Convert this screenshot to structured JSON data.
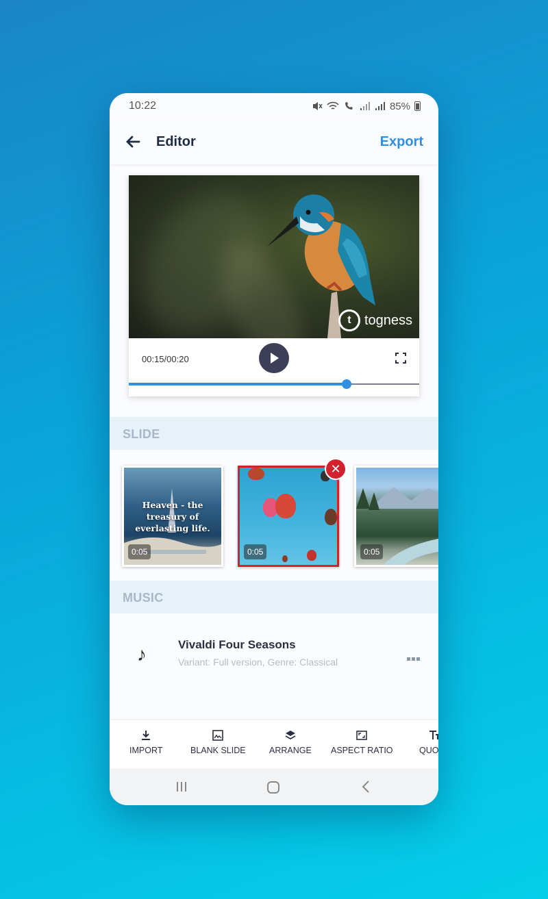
{
  "status_bar": {
    "time": "10:22",
    "battery": "85%"
  },
  "app_bar": {
    "title": "Editor",
    "export_label": "Export",
    "back_icon": "arrow-left-icon"
  },
  "player": {
    "time_display": "00:15/00:20",
    "progress": 0.75,
    "watermark": "togness",
    "watermark_logo_letter": "t",
    "play_icon": "play-icon",
    "fullscreen_icon": "fullscreen-icon"
  },
  "sections": {
    "slide_header": "SLIDE",
    "music_header": "MUSIC"
  },
  "slides": [
    {
      "quote": "Heaven - the treasury of everlasting life.",
      "duration": "0:05",
      "selected": false
    },
    {
      "quote": "",
      "duration": "0:05",
      "selected": true
    },
    {
      "quote": "",
      "duration": "0:05",
      "selected": false
    }
  ],
  "delete_icon": "close-icon",
  "delete_glyph": "✕",
  "music": {
    "note_glyph": "♪",
    "title": "Vivaldi Four Seasons",
    "subtitle": "Variant: Full version, Genre: Classical"
  },
  "toolbar": {
    "items": [
      {
        "label": "IMPORT",
        "icon": "download-icon"
      },
      {
        "label": "BLANK SLIDE",
        "icon": "blank-slide-icon"
      },
      {
        "label": "ARRANGE",
        "icon": "layers-icon"
      },
      {
        "label": "ASPECT RATIO",
        "icon": "aspect-ratio-icon"
      },
      {
        "label": "QUOTE",
        "icon": "text-icon"
      }
    ]
  },
  "colors": {
    "accent": "#2f8fe0",
    "delete": "#d3212d",
    "section_bg": "#e6f1fa"
  }
}
